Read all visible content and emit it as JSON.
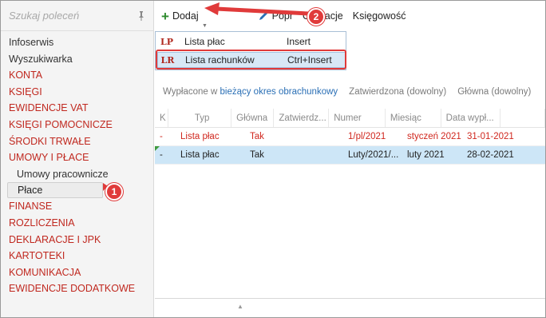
{
  "sidebar": {
    "search_placeholder": "Szukaj poleceń",
    "items": [
      {
        "label": "Infoserwis",
        "style": "plain"
      },
      {
        "label": "Wyszukiwarka",
        "style": "plain"
      },
      {
        "label": "KONTA",
        "style": "red"
      },
      {
        "label": "KSIĘGI",
        "style": "red"
      },
      {
        "label": "EWIDENCJE VAT",
        "style": "red"
      },
      {
        "label": "KSIĘGI POMOCNICZE",
        "style": "red"
      },
      {
        "label": "ŚRODKI TRWAŁE",
        "style": "red"
      },
      {
        "label": "UMOWY I PŁACE",
        "style": "red"
      },
      {
        "label": "Umowy pracownicze",
        "style": "sub"
      },
      {
        "label": "Płace",
        "style": "active"
      },
      {
        "label": "FINANSE",
        "style": "red"
      },
      {
        "label": "ROZLICZENIA",
        "style": "red"
      },
      {
        "label": "DEKLARACJE I JPK",
        "style": "red"
      },
      {
        "label": "KARTOTEKI",
        "style": "red"
      },
      {
        "label": "KOMUNIKACJA",
        "style": "red"
      },
      {
        "label": "EWIDENCJE DODATKOWE",
        "style": "red"
      }
    ]
  },
  "toolbar": {
    "add_label": "Dodaj",
    "edit_label": "Popr",
    "operations_label": "Operacje",
    "accounting_label": "Księgowość"
  },
  "dropdown": {
    "items": [
      {
        "badge": "LP",
        "label": "Lista płac",
        "shortcut": "Insert"
      },
      {
        "badge": "LR",
        "label": "Lista rachunków",
        "shortcut": "Ctrl+Insert"
      }
    ]
  },
  "filters": {
    "paid_prefix": "Wypłacone w",
    "paid_link": "bieżący okres obrachunkowy",
    "approved": "Zatwierdzona (dowolny)",
    "main": "Główna (dowolny)"
  },
  "table": {
    "headers": [
      "K",
      "Typ",
      "Główna",
      "Zatwierdz...",
      "Numer",
      "Miesiąc",
      "Data wypł..."
    ],
    "rows": [
      {
        "k": "-",
        "typ": "Lista płac",
        "glowna": "Tak",
        "zatw": "",
        "numer": "1/pl/2021",
        "miesiac": "styczeń 2021",
        "data": "31-01-2021"
      },
      {
        "k": "-",
        "typ": "Lista płac",
        "glowna": "Tak",
        "zatw": "",
        "numer": "Luty/2021/...",
        "miesiac": "luty 2021",
        "data": "28-02-2021"
      }
    ]
  },
  "annotations": {
    "step1": "1",
    "step2": "2"
  },
  "colors": {
    "accent_red": "#e03a3a",
    "nav_red": "#c0281f",
    "selection": "#cde6f7"
  }
}
